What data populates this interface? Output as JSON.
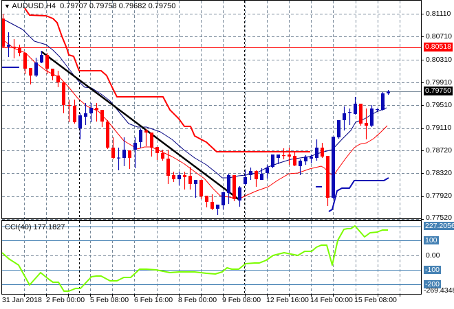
{
  "header": {
    "symbol_tf": "AUDUSD,H4",
    "open": "0.79707",
    "high": "0.79758",
    "low": "0.79682",
    "close": "0.79750",
    "menu_icon": "triangle-down-icon"
  },
  "price_axis": {
    "ticks": [
      "0.81110",
      "0.80710",
      "0.80310",
      "0.79910",
      "0.79510",
      "0.79110",
      "0.78720",
      "0.78320",
      "0.77920",
      "0.77520"
    ],
    "tick_values": [
      0.8111,
      0.8071,
      0.8031,
      0.7991,
      0.7951,
      0.7911,
      0.7872,
      0.7832,
      0.7792,
      0.7752
    ],
    "level_tag": {
      "label": "0.80518",
      "value": 0.80518,
      "color": "#ff0000"
    },
    "bid_tag": {
      "label": "0.79750",
      "value": 0.7975,
      "color": "#000000"
    }
  },
  "cci": {
    "title": "CCI(40) 177.1827",
    "axis_labels": {
      "max": "227.2056",
      "p100": "100",
      "zero": "0.00",
      "m100": "-100",
      "m200": "-200",
      "min": "-269.4348"
    },
    "line_color": "#7cfc00"
  },
  "time_axis": [
    "31 Jan 2018",
    "2 Feb 00:00",
    "5 Feb 08:00",
    "6 Feb 16:00",
    "8 Feb 00:00",
    "9 Feb 08:00",
    "12 Feb 16:00",
    "14 Feb 00:00",
    "15 Feb 08:00"
  ],
  "colors": {
    "bull": "#0a0ab4",
    "bear": "#ff0000",
    "grid": "#778899",
    "ma_fast": "#000080",
    "ma_slow": "#ff0000"
  },
  "trendline": {
    "from": {
      "candle": 7,
      "price": 0.8045
    },
    "to": {
      "candle": 43,
      "price": 0.77858
    }
  },
  "candles": [
    [
      0.81026,
      0.8111,
      0.8051,
      0.80534
    ],
    [
      0.80534,
      0.80786,
      0.80354,
      0.8057
    ],
    [
      0.80534,
      0.80666,
      0.8033,
      0.8051
    ],
    [
      0.8051,
      0.8057,
      0.80366,
      0.80426
    ],
    [
      0.80426,
      0.80426,
      0.80054,
      0.8015
    ],
    [
      0.80162,
      0.80162,
      0.79874,
      0.8003
    ],
    [
      0.8003,
      0.80342,
      0.80006,
      0.80258
    ],
    [
      0.80258,
      0.80462,
      0.80246,
      0.8039
    ],
    [
      0.8039,
      0.80426,
      0.80054,
      0.8015
    ],
    [
      0.8015,
      0.8015,
      0.79946,
      0.80018
    ],
    [
      0.8003,
      0.80114,
      0.79826,
      0.7991
    ],
    [
      0.7991,
      0.7991,
      0.7937,
      0.79514
    ],
    [
      0.79514,
      0.7961,
      0.79214,
      0.79502
    ],
    [
      0.79502,
      0.7961,
      0.7919,
      0.79214
    ],
    [
      0.79106,
      0.7937,
      0.78914,
      0.79334
    ],
    [
      0.7931,
      0.7955,
      0.79166,
      0.7937
    ],
    [
      0.7937,
      0.7955,
      0.79214,
      0.79466
    ],
    [
      0.79466,
      0.7955,
      0.79226,
      0.7943
    ],
    [
      0.7943,
      0.7943,
      0.7913,
      0.79226
    ],
    [
      0.79226,
      0.7925,
      0.78746,
      0.7877
    ],
    [
      0.7877,
      0.7895,
      0.78566,
      0.7859
    ],
    [
      0.7859,
      0.7877,
      0.78374,
      0.78596
    ],
    [
      0.7859,
      0.7895,
      0.78446,
      0.78734
    ],
    [
      0.78722,
      0.78722,
      0.78398,
      0.7859
    ],
    [
      0.78734,
      0.7895,
      0.7841,
      0.78854
    ],
    [
      0.78866,
      0.79106,
      0.7877,
      0.79082
    ],
    [
      0.7907,
      0.79094,
      0.78794,
      0.79034
    ],
    [
      0.79034,
      0.79034,
      0.78614,
      0.7877
    ],
    [
      0.78782,
      0.78782,
      0.78554,
      0.78674
    ],
    [
      0.78674,
      0.78734,
      0.78542,
      0.78578
    ],
    [
      0.78578,
      0.78734,
      0.78134,
      0.78278
    ],
    [
      0.7829,
      0.7835,
      0.7817,
      0.78218
    ],
    [
      0.78218,
      0.7835,
      0.7811,
      0.7829
    ],
    [
      0.7829,
      0.7835,
      0.78038,
      0.78254
    ],
    [
      0.78278,
      0.78434,
      0.78038,
      0.78134
    ],
    [
      0.78134,
      0.78206,
      0.77894,
      0.78206
    ],
    [
      0.78206,
      0.78206,
      0.7787,
      0.77918
    ],
    [
      0.7793,
      0.7793,
      0.77726,
      0.77822
    ],
    [
      0.77822,
      0.77954,
      0.77678,
      0.77702
    ],
    [
      0.77702,
      0.77774,
      0.77594,
      0.77774
    ],
    [
      0.77762,
      0.78002,
      0.7769,
      0.7799
    ],
    [
      0.77978,
      0.78314,
      0.77786,
      0.7829
    ],
    [
      0.7829,
      0.7829,
      0.77834,
      0.7787
    ],
    [
      0.77846,
      0.78098,
      0.77738,
      0.78074
    ],
    [
      0.78134,
      0.78374,
      0.7811,
      0.78254
    ],
    [
      0.7829,
      0.78422,
      0.78206,
      0.78362
    ],
    [
      0.78362,
      0.78374,
      0.78086,
      0.78218
    ],
    [
      0.78206,
      0.7841,
      0.78206,
      0.78314
    ],
    [
      0.78326,
      0.7847,
      0.7823,
      0.78422
    ],
    [
      0.78434,
      0.7865,
      0.7841,
      0.7865
    ],
    [
      0.7859,
      0.7865,
      0.78482,
      0.7865
    ],
    [
      0.78638,
      0.78758,
      0.78566,
      0.78626
    ],
    [
      0.7865,
      0.7877,
      0.7847,
      0.78614
    ],
    [
      0.78626,
      0.7871,
      0.78446,
      0.78458
    ],
    [
      0.78446,
      0.78566,
      0.7829,
      0.78542
    ],
    [
      0.7853,
      0.78638,
      0.7847,
      0.78614
    ],
    [
      0.78578,
      0.7865,
      0.78494,
      0.78614
    ],
    [
      0.7859,
      0.78914,
      0.78542,
      0.7877
    ],
    [
      0.7877,
      0.78854,
      0.7859,
      0.78614
    ],
    [
      0.78626,
      0.78626,
      0.7775,
      0.77894
    ],
    [
      0.77894,
      0.78962,
      0.7787,
      0.78962
    ],
    [
      0.7895,
      0.7925,
      0.78926,
      0.7925
    ],
    [
      0.7925,
      0.7949,
      0.7907,
      0.7937
    ],
    [
      0.79382,
      0.79454,
      0.79166,
      0.79394
    ],
    [
      0.79358,
      0.79658,
      0.79346,
      0.79538
    ],
    [
      0.79538,
      0.79538,
      0.79154,
      0.7919
    ],
    [
      0.79202,
      0.79454,
      0.78914,
      0.79154
    ],
    [
      0.79154,
      0.79514,
      0.7913,
      0.79454
    ],
    [
      0.7943,
      0.79454,
      0.79406,
      0.79442
    ],
    [
      0.7943,
      0.79742,
      0.79418,
      0.79718
    ],
    [
      0.79718,
      0.79778,
      0.79694,
      0.7975
    ]
  ]
}
